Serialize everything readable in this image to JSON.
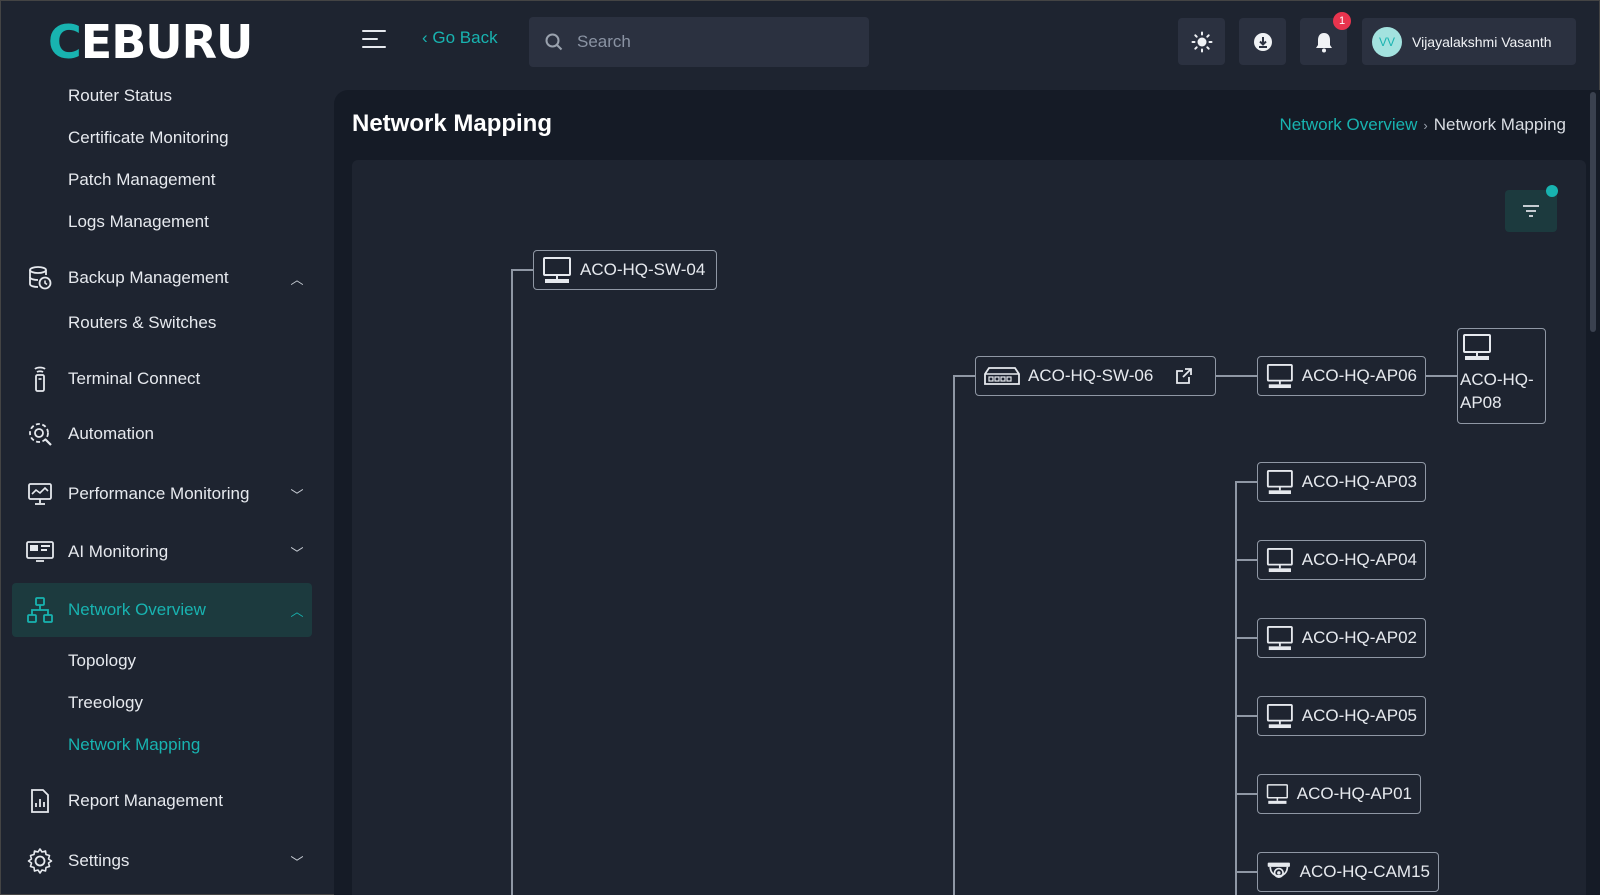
{
  "app": {
    "logo_text": "CEBURU",
    "logo_accent": "#18b3b0"
  },
  "header": {
    "go_back_label": "‹ Go Back",
    "search_placeholder": "Search",
    "notification_count": "1",
    "user": {
      "initials": "VV",
      "name": "Vijayalakshmi Vasanth"
    }
  },
  "sidebar": {
    "top_subitems": [
      "Router Status",
      "Certificate Monitoring",
      "Patch Management",
      "Logs Management"
    ],
    "backup": {
      "label": "Backup Management",
      "icon": "backup-icon",
      "children": [
        "Routers & Switches"
      ]
    },
    "terminal": {
      "label": "Terminal Connect",
      "icon": "terminal-icon"
    },
    "automation": {
      "label": "Automation",
      "icon": "automation-icon"
    },
    "performance": {
      "label": "Performance Monitoring",
      "icon": "performance-icon"
    },
    "ai": {
      "label": "AI Monitoring",
      "icon": "ai-monitor-icon"
    },
    "network": {
      "label": "Network Overview",
      "icon": "network-icon",
      "children": [
        "Topology",
        "Treeology",
        "Network Mapping"
      ],
      "active_child": "Network Mapping"
    },
    "report": {
      "label": "Report Management",
      "icon": "report-icon"
    },
    "settings": {
      "label": "Settings",
      "icon": "gear-icon"
    }
  },
  "page": {
    "title": "Network Mapping",
    "breadcrumb": {
      "parent": "Network Overview",
      "current": "Network Mapping"
    }
  },
  "map": {
    "nodes": {
      "sw04": {
        "label": "ACO-HQ-SW-04",
        "icon": "monitor-icon"
      },
      "sw06": {
        "label": "ACO-HQ-SW-06",
        "icon": "switch-icon"
      },
      "ap06": {
        "label": "ACO-HQ-AP06",
        "icon": "monitor-icon"
      },
      "ap08": {
        "label": "ACO-HQ-AP08",
        "icon": "monitor-icon"
      },
      "ap03": {
        "label": "ACO-HQ-AP03",
        "icon": "monitor-icon"
      },
      "ap04": {
        "label": "ACO-HQ-AP04",
        "icon": "monitor-icon"
      },
      "ap02": {
        "label": "ACO-HQ-AP02",
        "icon": "monitor-icon"
      },
      "ap05": {
        "label": "ACO-HQ-AP05",
        "icon": "monitor-icon"
      },
      "ap01": {
        "label": "ACO-HQ-AP01",
        "icon": "monitor-icon"
      },
      "cam15": {
        "label": "ACO-HQ-CAM15",
        "icon": "camera-icon"
      }
    }
  }
}
